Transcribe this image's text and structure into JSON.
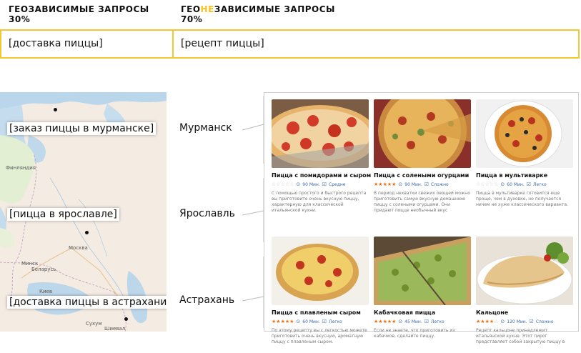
{
  "header": {
    "left_title": "ГЕОЗАВИСИМЫЕ ЗАПРОСЫ",
    "left_percent": "30%",
    "right_title_pre": "ГЕО",
    "right_title_hl": "НЕ",
    "right_title_post": "ЗАВИСИМЫЕ ЗАПРОСЫ",
    "right_percent": "70%"
  },
  "queries": {
    "left": "[доставка пиццы]",
    "right": "[рецепт пиццы]"
  },
  "map": {
    "tags": [
      "[заказ пиццы в мурманске]",
      "[пицца в ярославле]",
      "[доставка пиццы в астрахани]"
    ],
    "labels": [
      "Финляндия",
      "Москва",
      "Минск",
      "Беларусь",
      "Киев",
      "Сухум",
      "Шиевал"
    ]
  },
  "cities": [
    "Мурманск",
    "Ярославль",
    "Астрахань"
  ],
  "cards": [
    {
      "title": "Пицца с помидорами и сыром",
      "stars": 0,
      "time": "90 Мин.",
      "level": "Средне",
      "desc": "С помощью простого и быстрого рецепта вы приготовите очень вкусную пиццу, характерную для классической итальянской кухни."
    },
    {
      "title": "Пицца с солеными огурцами",
      "stars": 5,
      "time": "90 Мин.",
      "level": "Сложно",
      "desc": "В период нехватки свежих овощей можно приготовить самую вкусную домашнюю пиццу с солеными огурцами. Они придают пицце необычный вкус"
    },
    {
      "title": "Пицца в мультиварке",
      "stars": 0,
      "time": "60 Мин.",
      "level": "Легко",
      "desc": "Пицца в мультиварке готовится еще проще, чем в духовке, но получается ничем не хуже классического варианта."
    },
    {
      "title": "Пицца с плавленым сыром",
      "stars": 5,
      "time": "60 Мин.",
      "level": "Легко",
      "desc": "По этому рецепту вы с легкостью можете приготовить очень вкусную, ароматную пиццу с плавленым сыром."
    },
    {
      "title": "Кабачковая пицца",
      "stars": 5,
      "time": "45 Мин.",
      "level": "Легко",
      "desc": "Если не знаете, что приготовить из кабачков, сделайте пиццу."
    },
    {
      "title": "Кальцоне",
      "stars": 4,
      "time": "120 Мин.",
      "level": "Сложно",
      "desc": "Рецепт кальцоне принадлежит итальянской кухне. Этот пирог представляет собой закрытую пиццу в"
    }
  ]
}
